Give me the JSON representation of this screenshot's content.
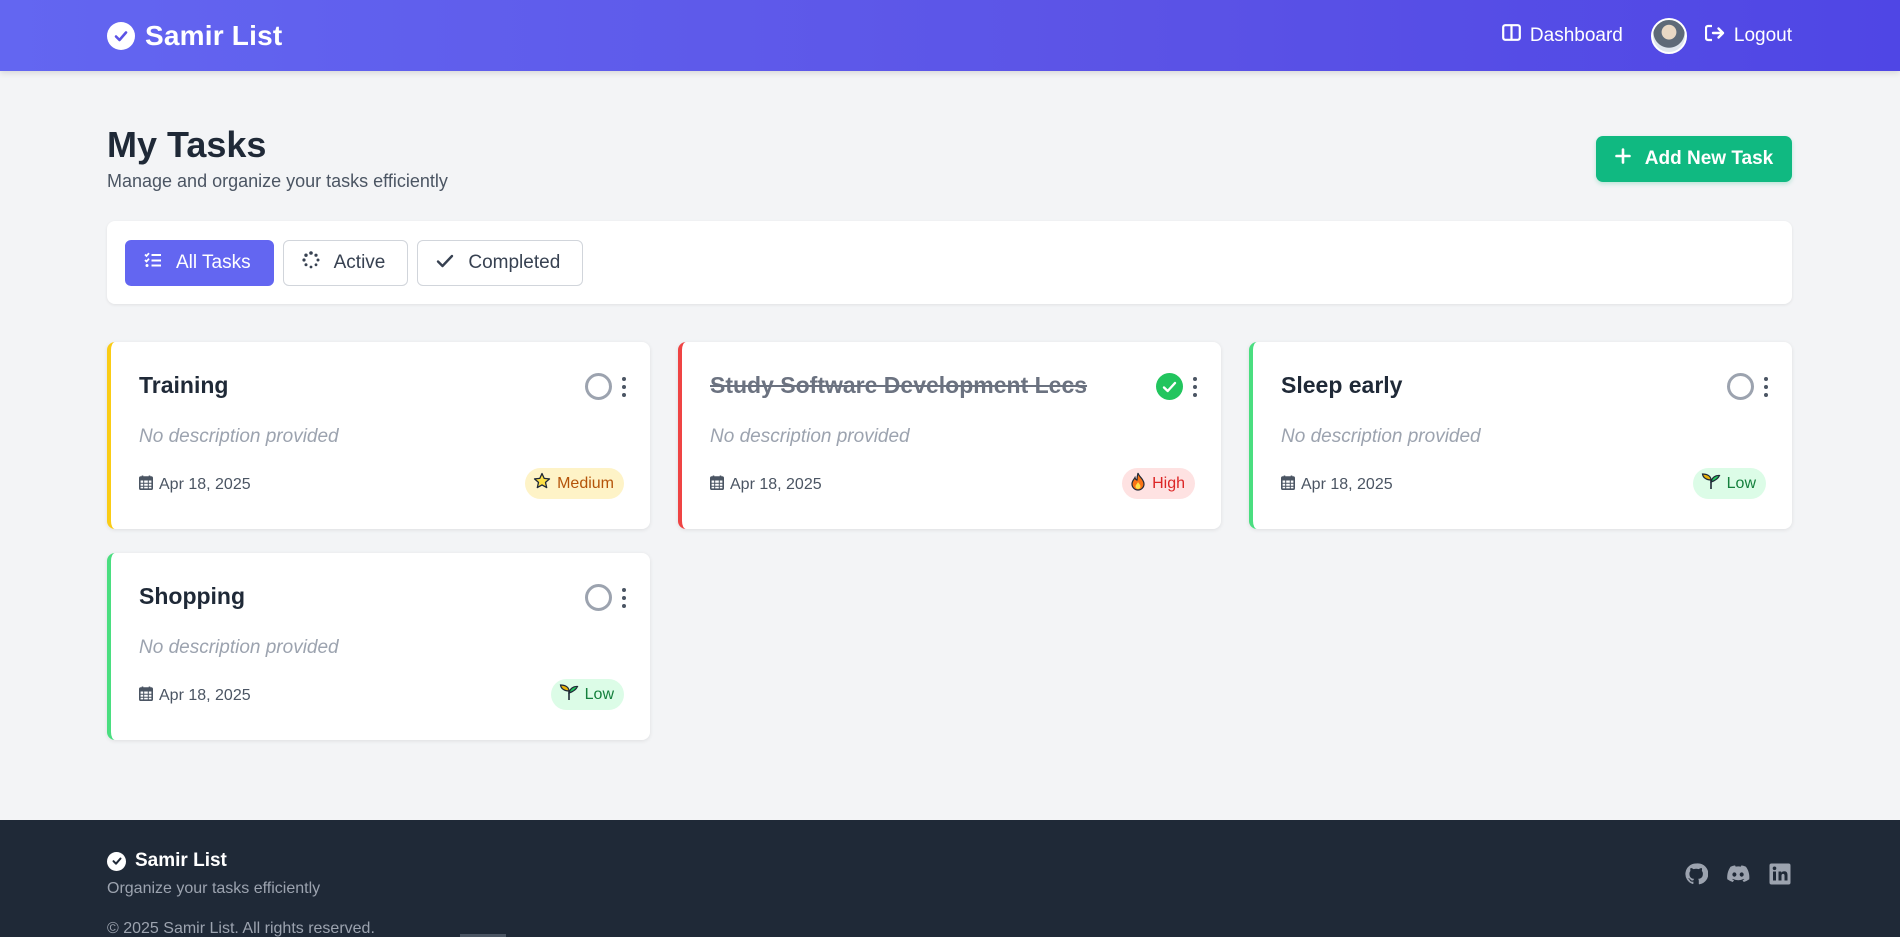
{
  "header": {
    "brand": "Samir List",
    "dashboard_label": "Dashboard",
    "logout_label": "Logout"
  },
  "page": {
    "title": "My Tasks",
    "subtitle": "Manage and organize your tasks efficiently",
    "add_button_label": "Add New Task"
  },
  "filters": [
    {
      "label": "All Tasks",
      "icon": "list-check-icon",
      "active": true
    },
    {
      "label": "Active",
      "icon": "spinner-icon",
      "active": false
    },
    {
      "label": "Completed",
      "icon": "check-icon",
      "active": false
    }
  ],
  "tasks": [
    {
      "title": "Training",
      "description": "No description provided",
      "date": "Apr 18, 2025",
      "priority": "Medium",
      "priority_icon": "star-icon",
      "completed": false,
      "accent": "#facc15"
    },
    {
      "title": "Study Software Development Lecs",
      "description": "No description provided",
      "date": "Apr 18, 2025",
      "priority": "High",
      "priority_icon": "fire-icon",
      "completed": true,
      "accent": "#ef4444"
    },
    {
      "title": "Sleep early",
      "description": "No description provided",
      "date": "Apr 18, 2025",
      "priority": "Low",
      "priority_icon": "seedling-icon",
      "completed": false,
      "accent": "#4ade80"
    },
    {
      "title": "Shopping",
      "description": "No description provided",
      "date": "Apr 18, 2025",
      "priority": "Low",
      "priority_icon": "seedling-icon",
      "completed": false,
      "accent": "#4ade80"
    }
  ],
  "footer": {
    "brand": "Samir List",
    "tagline": "Organize your tasks efficiently",
    "copyright": "© 2025 Samir List. All rights reserved.",
    "social": [
      "github-icon",
      "discord-icon",
      "linkedin-icon"
    ]
  },
  "colors": {
    "primary": "#6366f1",
    "success": "#10b981",
    "footer_bg": "#1f2937"
  }
}
